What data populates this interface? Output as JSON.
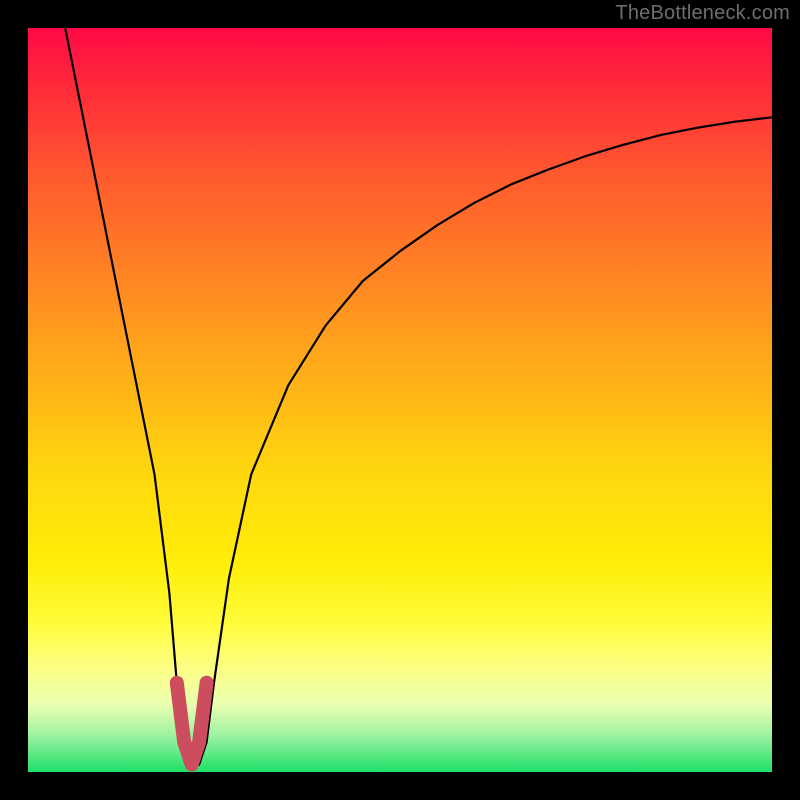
{
  "attribution": "TheBottleneck.com",
  "chart_data": {
    "type": "line",
    "title": "",
    "xlabel": "",
    "ylabel": "",
    "xlim": [
      0,
      100
    ],
    "ylim": [
      0,
      100
    ],
    "series": [
      {
        "name": "bottleneck-curve",
        "x": [
          5,
          7,
          9,
          11,
          13,
          15,
          17,
          19,
          20,
          21,
          22,
          23,
          24,
          25,
          27,
          30,
          35,
          40,
          45,
          50,
          55,
          60,
          65,
          70,
          75,
          80,
          85,
          90,
          95,
          100
        ],
        "values": [
          100,
          90,
          80,
          70,
          60,
          50,
          40,
          24,
          12,
          4,
          1,
          1,
          4,
          12,
          26,
          40,
          52,
          60,
          66,
          70,
          73.5,
          76.5,
          79,
          81,
          82.8,
          84.3,
          85.6,
          86.6,
          87.4,
          88
        ]
      }
    ],
    "valley_marker": {
      "x": [
        20,
        21,
        22,
        23,
        24
      ],
      "values": [
        12,
        4,
        1,
        4,
        12
      ]
    },
    "background_gradient": {
      "top": "#ff0a46",
      "middle": "#ffee08",
      "bottom": "#1fe06a"
    }
  }
}
